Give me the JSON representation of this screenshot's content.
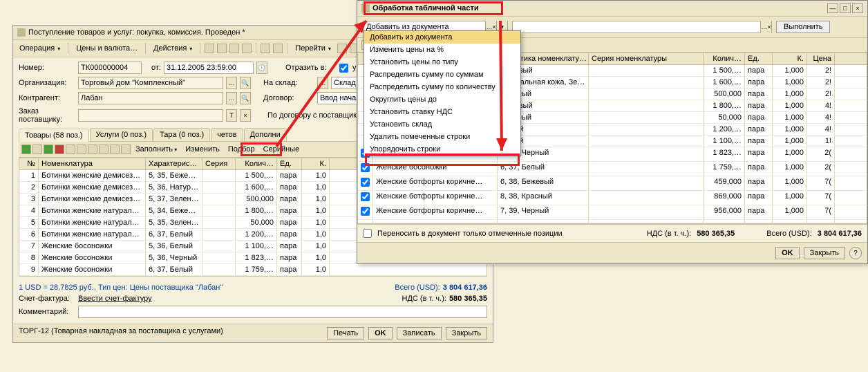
{
  "main": {
    "title": "Поступление товаров и услуг: покупка, комиссия. Проведен *",
    "toolbar": {
      "operation": "Операция",
      "prices": "Цены и валюта…",
      "actions": "Действия",
      "goto": "Перейти"
    },
    "form": {
      "number_lbl": "Номер:",
      "number": "ТК000000004",
      "date_lbl": "от:",
      "date": "31.12.2005 23:59:00",
      "reflect_lbl": "Отразить в:",
      "reflect_chk": "упр. учете",
      "org_lbl": "Организация:",
      "org": "Торговый дом \"Комплексный\"",
      "sklad_lbl": "На склад:",
      "sklad": "Склад обуви",
      "kontr_lbl": "Контрагент:",
      "kontr": "Лабан",
      "dogovor_lbl": "Договор:",
      "dogovor": "Ввод начальных",
      "zakaz_lbl": "Заказ поставщику:",
      "contract_note": "По договору с поставщиком нет"
    },
    "tabs": {
      "t1": "Товары (58 поз.)",
      "t2": "Услуги (0 поз.)",
      "t3": "Тара (0 поз.)",
      "t4": "четов",
      "t5": "Дополни"
    },
    "inner_tb": {
      "fill": "Заполнить",
      "change": "Изменить",
      "select": "Подбор",
      "serial": "Серийные"
    },
    "grid": {
      "head": {
        "n": "№",
        "nom": "Номенклатура",
        "char": "Характеристи…",
        "ser": "Серия",
        "kol": "Колич…",
        "ed": "Ед.",
        "k": "К."
      },
      "rows": [
        {
          "n": "1",
          "nom": "Ботинки женские демисезо…",
          "char": "5, 35, Бежевый",
          "ser": "",
          "kol": "1 500,…",
          "ed": "пара",
          "k": "1,0"
        },
        {
          "n": "2",
          "nom": "Ботинки женские демисезо…",
          "char": "5, 36, Натурал…",
          "ser": "",
          "kol": "1 600,…",
          "ed": "пара",
          "k": "1,0"
        },
        {
          "n": "3",
          "nom": "Ботинки женские демисезо…",
          "char": "5, 37, Зеленый",
          "ser": "",
          "kol": "500,000",
          "ed": "пара",
          "k": "1,0"
        },
        {
          "n": "4",
          "nom": "Ботинки женские натуральн…",
          "char": "5, 34, Бежевый",
          "ser": "",
          "kol": "1 800,…",
          "ed": "пара",
          "k": "1,0"
        },
        {
          "n": "5",
          "nom": "Ботинки женские натуральн…",
          "char": "5, 35, Зеленый",
          "ser": "",
          "kol": "50,000",
          "ed": "пара",
          "k": "1,0"
        },
        {
          "n": "6",
          "nom": "Ботинки женские натуральн…",
          "char": "6, 37, Белый",
          "ser": "",
          "kol": "1 200,…",
          "ed": "пара",
          "k": "1,0"
        },
        {
          "n": "7",
          "nom": "Женские босоножки",
          "char": "5, 36, Белый",
          "ser": "",
          "kol": "1 100,…",
          "ed": "пара",
          "k": "1,0"
        },
        {
          "n": "8",
          "nom": "Женские босоножки",
          "char": "5, 36, Черный",
          "ser": "",
          "kol": "1 823,…",
          "ed": "пара",
          "k": "1,0"
        },
        {
          "n": "9",
          "nom": "Женские босоножки",
          "char": "6, 37, Белый",
          "ser": "",
          "kol": "1 759,…",
          "ed": "пара",
          "k": "1,0"
        }
      ]
    },
    "footer": {
      "rate": "1 USD = 28,7825 руб., Тип цен: Цены поставщика \"Лабан\"",
      "total_lbl": "Всего (USD):",
      "total": "3 804 617,36",
      "invoice_lbl": "Счет-фактура:",
      "invoice_link": "Ввести счет-фактуру",
      "nds_lbl": "НДС (в т. ч.):",
      "nds": "580 365,35",
      "comment_lbl": "Комментарий:"
    },
    "bottom": {
      "torg": "ТОРГ-12 (Товарная накладная за поставщика с услугами)",
      "print": "Печать",
      "ok": "OK",
      "save": "Записать",
      "close": "Закрыть"
    }
  },
  "popup": {
    "title": "Обработка табличной части",
    "combo_sel": "Добавить из документа",
    "exec": "Выполнить",
    "tb_icons": [
      "copy-icon",
      "paste-icon",
      "doc-icon"
    ],
    "grid": {
      "head": {
        "char": "теристика номенклату…",
        "ser": "Серия номенклатуры",
        "kol": "Колич…",
        "ed": "Ед.",
        "k": "К.",
        "price": "Цена"
      },
      "rows": [
        {
          "chk": false,
          "nom": "",
          "char": "Бежевый",
          "ser": "",
          "kol": "1 500,…",
          "ed": "пара",
          "k": "1,000",
          "price": "2!"
        },
        {
          "chk": false,
          "nom": "",
          "char": "натуральная кожа, Зе…",
          "ser": "",
          "kol": "1 600,…",
          "ed": "пара",
          "k": "1,000",
          "price": "2!"
        },
        {
          "chk": false,
          "nom": "",
          "char": "Зеленый",
          "ser": "",
          "kol": "500,000",
          "ed": "пара",
          "k": "1,000",
          "price": "2!"
        },
        {
          "chk": false,
          "nom": "",
          "char": "Бежевый",
          "ser": "",
          "kol": "1 800,…",
          "ed": "пара",
          "k": "1,000",
          "price": "4!"
        },
        {
          "chk": false,
          "nom": "",
          "char": "Зеленый",
          "ser": "",
          "kol": "50,000",
          "ed": "пара",
          "k": "1,000",
          "price": "4!"
        },
        {
          "chk": false,
          "nom": "",
          "char": "Белый",
          "ser": "",
          "kol": "1 200,…",
          "ed": "пара",
          "k": "1,000",
          "price": "4!"
        },
        {
          "chk": false,
          "nom": "",
          "char": "Белый",
          "ser": "",
          "kol": "1 100,…",
          "ed": "пара",
          "k": "1,000",
          "price": "1!"
        },
        {
          "chk": true,
          "nom": "Женские босоножки",
          "char": "5, 36, Черный",
          "ser": "",
          "kol": "1 823,…",
          "ed": "пара",
          "k": "1,000",
          "price": "2("
        },
        {
          "chk": true,
          "nom": "Женские босоножки",
          "char": "6, 37, Белый",
          "ser": "",
          "kol": "1 759,…",
          "ed": "пара",
          "k": "1,000",
          "price": "2("
        },
        {
          "chk": true,
          "nom": "Женские ботфорты коричне…",
          "char": "6, 38, Бежевый",
          "ser": "",
          "kol": "459,000",
          "ed": "пара",
          "k": "1,000",
          "price": "7("
        },
        {
          "chk": true,
          "nom": "Женские ботфорты коричне…",
          "char": "8, 38, Красный",
          "ser": "",
          "kol": "869,000",
          "ed": "пара",
          "k": "1,000",
          "price": "7("
        },
        {
          "chk": true,
          "nom": "Женские ботфорты коричне…",
          "char": "7, 39, Черный",
          "ser": "",
          "kol": "956,000",
          "ed": "пара",
          "k": "1,000",
          "price": "7("
        },
        {
          "chk": false,
          "nom": "",
          "char": "",
          "ser": "",
          "kol": "",
          "ed": "",
          "k": "",
          "price": ""
        }
      ]
    },
    "strip": {
      "checkbox": "Переносить в документ только отмеченные позиции",
      "nds_lbl": "НДС (в т. ч.):",
      "nds": "580 365,35",
      "total_lbl": "Всего (USD):",
      "total": "3 804 617,36"
    },
    "bottom": {
      "ok": "OK",
      "close": "Закрыть"
    }
  },
  "dropdown": {
    "items": [
      "Добавить из документа",
      "Изменить цены на %",
      "Установить цены по типу",
      "Распределить сумму по суммам",
      "Распределить сумму по количеству",
      "Округлить цены до",
      "Установить ставку НДС",
      "Установить склад",
      "Удалить помеченные строки",
      "Упорядочить строки"
    ],
    "selected_index": 0
  }
}
